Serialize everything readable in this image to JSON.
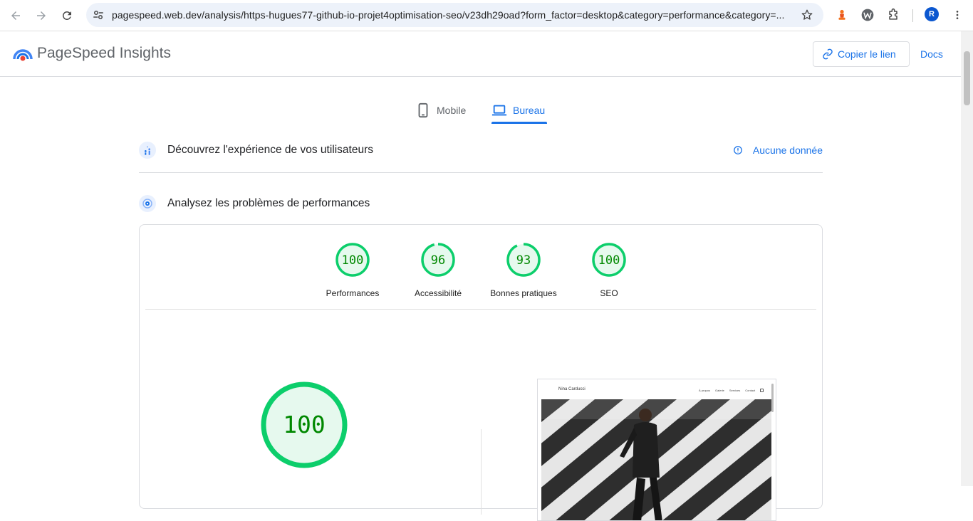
{
  "browser": {
    "url": "pagespeed.web.dev/analysis/https-hugues77-github-io-projet4optimisation-seo/v23dh29oad?form_factor=desktop&category=performance&category=...",
    "avatar_letter": "R"
  },
  "header": {
    "brand": "PageSpeed Insights",
    "copy_link": "Copier le lien",
    "docs": "Docs"
  },
  "tabs": [
    {
      "label": "Mobile",
      "active": false
    },
    {
      "label": "Bureau",
      "active": true
    }
  ],
  "sections": {
    "field_data": {
      "title": "Découvrez l'expérience de vos utilisateurs",
      "status": "Aucune donnée"
    },
    "lab_data": {
      "title": "Analysez les problèmes de performances"
    }
  },
  "scores": [
    {
      "label": "Performances",
      "score": "100",
      "value": 100
    },
    {
      "label": "Accessibilité",
      "score": "96",
      "value": 96
    },
    {
      "label": "Bonnes pratiques",
      "score": "93",
      "value": 93
    },
    {
      "label": "SEO",
      "score": "100",
      "value": 100
    }
  ],
  "main_score": {
    "score": "100",
    "value": 100
  },
  "preview": {
    "site_name": "Nina Carducci",
    "nav_links": [
      "À propos",
      "Galerie",
      "Services",
      "Contact"
    ]
  },
  "colors": {
    "pass": "#0cce6b",
    "pass_fill": "#e6f9ee",
    "pass_text": "#008800",
    "accent": "#1a73e8"
  }
}
